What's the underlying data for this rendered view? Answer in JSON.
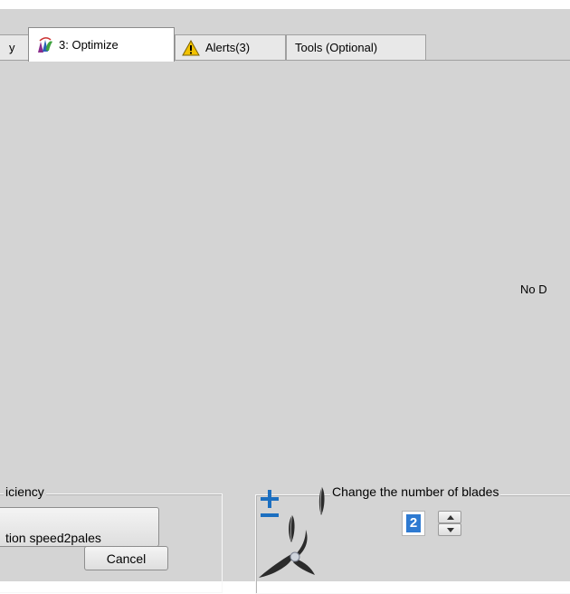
{
  "tabs": [
    {
      "label": "y",
      "icon": "none"
    },
    {
      "label": "3: Optimize",
      "icon": "optimize-icon"
    },
    {
      "label": "Alerts(3)",
      "icon": "warning-icon"
    },
    {
      "label": "Tools (Optional)",
      "icon": "none"
    }
  ],
  "main": {
    "no_data_text": "No D"
  },
  "efficiency_group": {
    "title": "iciency",
    "run_button": "tion speed2pales",
    "cancel_button": "Cancel"
  },
  "blades_group": {
    "title": "Change the number of blades",
    "blade_count": "2"
  },
  "colors": {
    "background": "#d4d4d4",
    "selection": "#2e7ad1",
    "plus_minus": "#1c6fc0",
    "warning": "#f2c200"
  }
}
